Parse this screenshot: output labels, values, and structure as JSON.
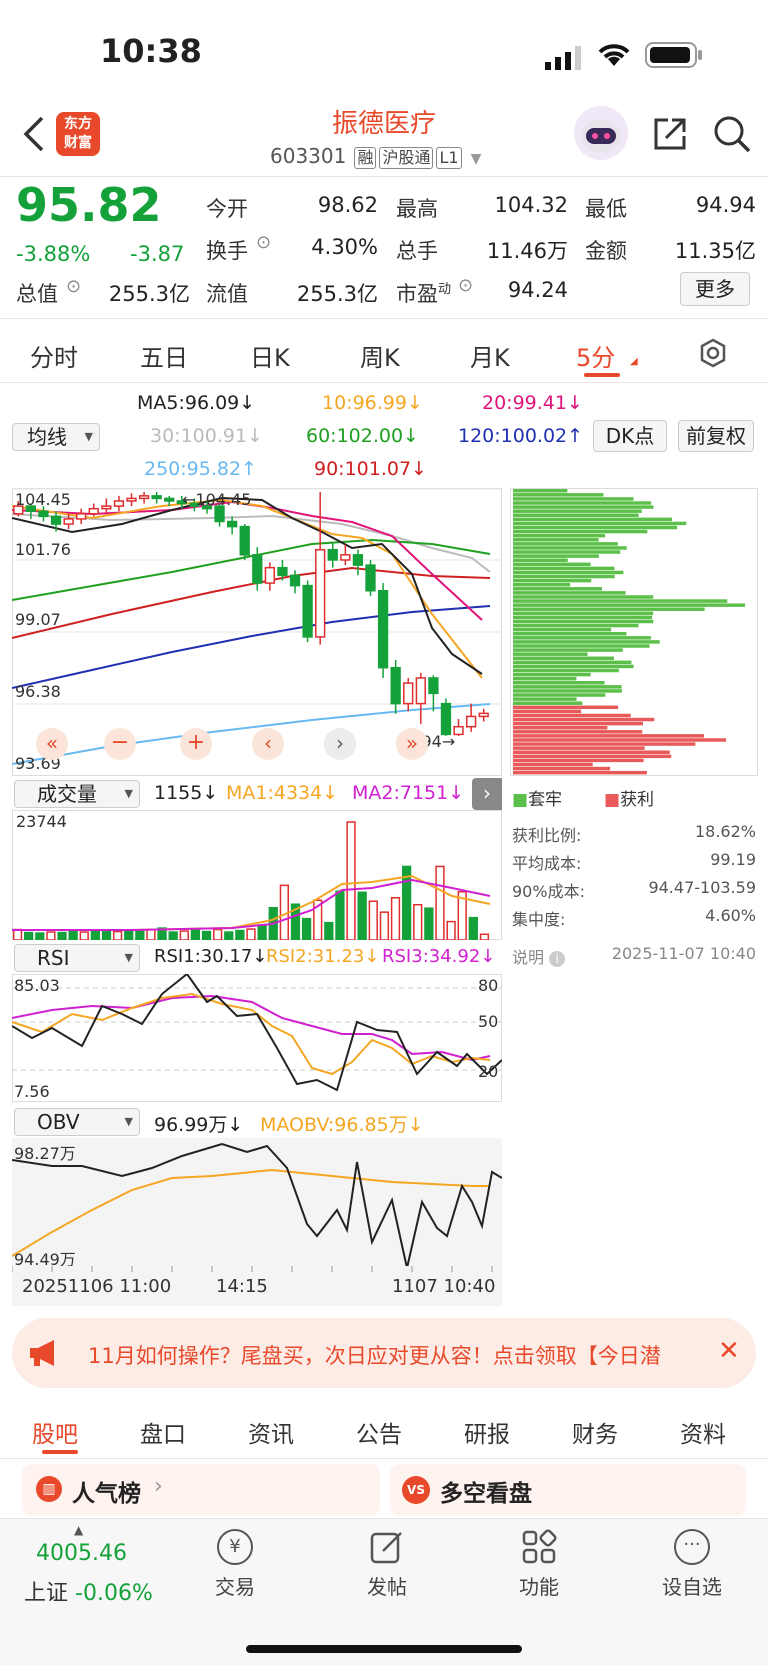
{
  "status": {
    "time": "10:38"
  },
  "header": {
    "title": "振德医疗",
    "code": "603301",
    "tags": [
      "融",
      "沪股通",
      "L1"
    ],
    "logo_text": "东方\n财富"
  },
  "quote": {
    "price": "95.82",
    "change_pct": "-3.88%",
    "change": "-3.87",
    "open_label": "今开",
    "open": "98.62",
    "high_label": "最高",
    "high": "104.32",
    "low_label": "最低",
    "low": "94.94",
    "turnover_label": "换手",
    "turnover": "4.30%",
    "volume_label": "总手",
    "volume": "11.46万",
    "amount_label": "金额",
    "amount": "11.35亿",
    "mcap_label": "总值",
    "mcap": "255.3亿",
    "float_label": "流值",
    "float": "255.3亿",
    "pe_label": "市盈",
    "pe_sup": "动",
    "pe": "94.24",
    "more_label": "更多"
  },
  "tabs": [
    "分时",
    "五日",
    "日K",
    "周K",
    "月K",
    "5分"
  ],
  "ma_panel": {
    "select": "均线",
    "ma5": "MA5:96.09↓",
    "ma10": "10:96.99↓",
    "ma20": "20:99.41↓",
    "ma30": "30:100.91↓",
    "ma60": "60:102.00↓",
    "ma120": "120:100.02↑",
    "ma250": "250:95.82↑",
    "ma90": "90:101.07↓",
    "dk": "DK点",
    "fq": "前复权"
  },
  "colors": {
    "up": "#e02d2d",
    "down": "#15a13a",
    "ma5": "#222222",
    "ma10": "#f5a623",
    "ma20": "#e0157a",
    "ma30": "#bbbbbb",
    "ma60": "#20a020",
    "ma120": "#2030b0",
    "ma250": "#6ab8f0",
    "ma90": "#d02020",
    "accent": "#e8492a"
  },
  "chart_data": [
    {
      "type": "candlestick",
      "title": "5分",
      "y_ticks": [
        "104.45",
        "101.76",
        "99.07",
        "96.38",
        "93.69"
      ],
      "ylim": [
        93.69,
        104.45
      ],
      "annotations": [
        "104.45",
        "94.94"
      ],
      "candles": [
        {
          "o": 103.6,
          "c": 103.9,
          "h": 104.1,
          "l": 103.5
        },
        {
          "o": 103.9,
          "c": 103.7,
          "h": 104.0,
          "l": 103.4
        },
        {
          "o": 103.7,
          "c": 103.5,
          "h": 103.9,
          "l": 103.3
        },
        {
          "o": 103.5,
          "c": 103.2,
          "h": 103.7,
          "l": 102.9
        },
        {
          "o": 103.2,
          "c": 103.4,
          "h": 103.6,
          "l": 103.0
        },
        {
          "o": 103.4,
          "c": 103.6,
          "h": 103.8,
          "l": 103.2
        },
        {
          "o": 103.6,
          "c": 103.8,
          "h": 104.0,
          "l": 103.5
        },
        {
          "o": 103.8,
          "c": 103.9,
          "h": 104.2,
          "l": 103.6
        },
        {
          "o": 103.9,
          "c": 104.1,
          "h": 104.3,
          "l": 103.7
        },
        {
          "o": 104.1,
          "c": 104.2,
          "h": 104.4,
          "l": 103.9
        },
        {
          "o": 104.2,
          "c": 104.3,
          "h": 104.45,
          "l": 104.0
        },
        {
          "o": 104.3,
          "c": 104.2,
          "h": 104.45,
          "l": 104.0
        },
        {
          "o": 104.2,
          "c": 104.1,
          "h": 104.3,
          "l": 103.9
        },
        {
          "o": 104.1,
          "c": 104.0,
          "h": 104.3,
          "l": 103.8
        },
        {
          "o": 104.0,
          "c": 103.9,
          "h": 104.2,
          "l": 103.7
        },
        {
          "o": 103.9,
          "c": 103.8,
          "h": 104.1,
          "l": 103.6
        },
        {
          "o": 103.9,
          "c": 103.3,
          "h": 104.0,
          "l": 103.1
        },
        {
          "o": 103.3,
          "c": 103.1,
          "h": 103.5,
          "l": 102.8
        },
        {
          "o": 103.1,
          "c": 102.0,
          "h": 103.2,
          "l": 101.8
        },
        {
          "o": 102.0,
          "c": 100.9,
          "h": 102.3,
          "l": 100.6
        },
        {
          "o": 100.9,
          "c": 101.5,
          "h": 101.7,
          "l": 100.6
        },
        {
          "o": 101.5,
          "c": 101.2,
          "h": 101.8,
          "l": 101.0
        },
        {
          "o": 101.2,
          "c": 100.8,
          "h": 101.4,
          "l": 100.5
        },
        {
          "o": 100.8,
          "c": 98.8,
          "h": 101.0,
          "l": 98.6
        },
        {
          "o": 98.8,
          "c": 102.2,
          "h": 104.45,
          "l": 98.5
        },
        {
          "o": 102.2,
          "c": 101.8,
          "h": 102.5,
          "l": 101.5
        },
        {
          "o": 101.8,
          "c": 102.0,
          "h": 102.4,
          "l": 101.6
        },
        {
          "o": 102.0,
          "c": 101.6,
          "h": 102.2,
          "l": 101.2
        },
        {
          "o": 101.6,
          "c": 100.6,
          "h": 101.8,
          "l": 100.4
        },
        {
          "o": 100.6,
          "c": 97.6,
          "h": 100.9,
          "l": 97.2
        },
        {
          "o": 97.6,
          "c": 96.2,
          "h": 97.9,
          "l": 95.8
        },
        {
          "o": 96.2,
          "c": 97.0,
          "h": 97.2,
          "l": 95.9
        },
        {
          "o": 96.2,
          "c": 97.2,
          "h": 97.4,
          "l": 95.4
        },
        {
          "o": 97.2,
          "c": 96.6,
          "h": 97.3,
          "l": 95.9
        },
        {
          "o": 96.2,
          "c": 95.0,
          "h": 96.4,
          "l": 94.94
        },
        {
          "o": 95.0,
          "c": 95.3,
          "h": 95.6,
          "l": 94.94
        },
        {
          "o": 95.3,
          "c": 95.7,
          "h": 96.2,
          "l": 95.1
        },
        {
          "o": 95.7,
          "c": 95.82,
          "h": 96.0,
          "l": 95.5
        }
      ]
    },
    {
      "type": "bar",
      "title": "成交量",
      "readouts": [
        "1155↓",
        "MA1:4334↓",
        "MA2:7151↓"
      ],
      "y_ticks": [
        "23744"
      ],
      "values": [
        2100,
        1500,
        1400,
        1600,
        1500,
        1700,
        1600,
        1800,
        1800,
        1700,
        2000,
        1900,
        2100,
        2400,
        1600,
        1800,
        2000,
        1700,
        2100,
        1600,
        1900,
        2200,
        3000,
        6500,
        11000,
        7200,
        4300,
        8000,
        3500,
        9800,
        23744,
        9600,
        7800,
        5600,
        8500,
        14800,
        7100,
        6400,
        14800,
        3700,
        9700,
        4500,
        1155
      ]
    },
    {
      "type": "line",
      "title": "RSI",
      "readouts": [
        "RSI1:30.17↓",
        "RSI2:31.23↓",
        "RSI3:34.92↓"
      ],
      "y_ticks": [
        "85.03",
        "7.56"
      ],
      "ref_lines": [
        "80",
        "50",
        "20"
      ]
    },
    {
      "type": "line",
      "title": "OBV",
      "readouts": [
        "96.99万↓",
        "MAOBV:96.85万↓"
      ],
      "y_ticks": [
        "98.27万",
        "94.49万"
      ],
      "x_ticks": [
        "20251106 11:00",
        "14:15",
        "1107 10:40"
      ]
    }
  ],
  "chips": {
    "legend_trapped": "套牢",
    "legend_profit": "获利",
    "rows": [
      {
        "k": "获利比例:",
        "v": "18.62%"
      },
      {
        "k": "平均成本:",
        "v": "99.19"
      },
      {
        "k": "90%成本:",
        "v": "94.47-103.59"
      },
      {
        "k": "集中度:",
        "v": "4.60%"
      }
    ],
    "note": "说明",
    "date": "2025-11-07 10:40"
  },
  "banner": {
    "text": "11月如何操作？尾盘买，次日应对更从容！点击领取【今日潜"
  },
  "bottom_tabs": [
    "股吧",
    "盘口",
    "资讯",
    "公告",
    "研报",
    "财务",
    "资料"
  ],
  "cards": [
    "人气榜",
    "多空看盘"
  ],
  "nav": {
    "index_value": "4005.46",
    "index_name": "上证",
    "index_change": "-0.06%",
    "items": [
      "交易",
      "发帖",
      "功能",
      "设自选"
    ]
  }
}
